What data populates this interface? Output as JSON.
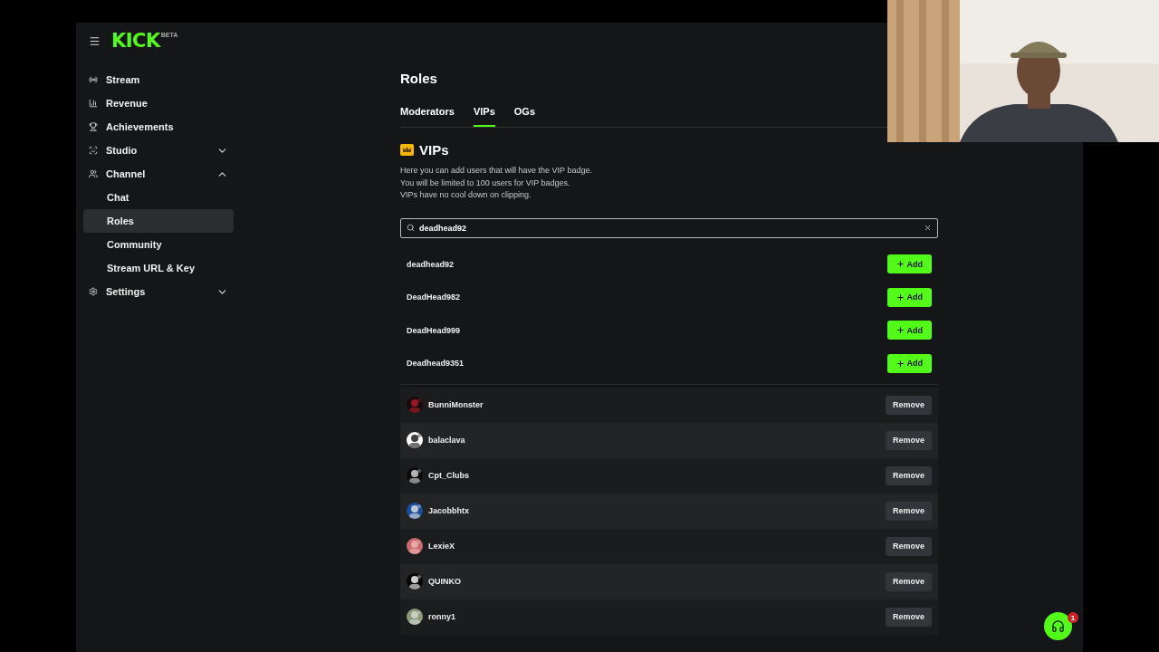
{
  "logo": {
    "wordmark": "KICK",
    "tag": "BETA"
  },
  "sidebar": {
    "items": [
      {
        "label": "Stream",
        "selected": false
      },
      {
        "label": "Revenue",
        "selected": false
      },
      {
        "label": "Achievements",
        "selected": false
      },
      {
        "label": "Studio",
        "selected": false,
        "expanded": false
      },
      {
        "label": "Channel",
        "selected": false,
        "expanded": true,
        "children": [
          {
            "label": "Chat",
            "selected": false
          },
          {
            "label": "Roles",
            "selected": true
          },
          {
            "label": "Community",
            "selected": false
          },
          {
            "label": "Stream URL & Key",
            "selected": false
          }
        ]
      },
      {
        "label": "Settings",
        "selected": false,
        "expanded": false
      }
    ]
  },
  "page": {
    "title": "Roles",
    "tabs": [
      {
        "label": "Moderators",
        "selected": false
      },
      {
        "label": "VIPs",
        "selected": true
      },
      {
        "label": "OGs",
        "selected": false
      }
    ],
    "section": {
      "title": "VIPs",
      "description": [
        "Here you can add users that will have the VIP badge.",
        "You will be limited to 100 users for VIP badges.",
        "VIPs have no cool down on clipping."
      ]
    },
    "search": {
      "value": "deadhead92"
    },
    "results": [
      {
        "name": "deadhead92",
        "action": "Add"
      },
      {
        "name": "DeadHead982",
        "action": "Add"
      },
      {
        "name": "DeadHead999",
        "action": "Add"
      },
      {
        "name": "Deadhead9351",
        "action": "Add"
      }
    ],
    "members": [
      {
        "name": "BunniMonster",
        "action": "Remove"
      },
      {
        "name": "balaclava",
        "action": "Remove"
      },
      {
        "name": "Cpt_Clubs",
        "action": "Remove"
      },
      {
        "name": "Jacobbhtx",
        "action": "Remove"
      },
      {
        "name": "LexieX",
        "action": "Remove"
      },
      {
        "name": "QUINKO",
        "action": "Remove"
      },
      {
        "name": "ronny1",
        "action": "Remove"
      }
    ]
  },
  "help": {
    "badge": "1"
  }
}
